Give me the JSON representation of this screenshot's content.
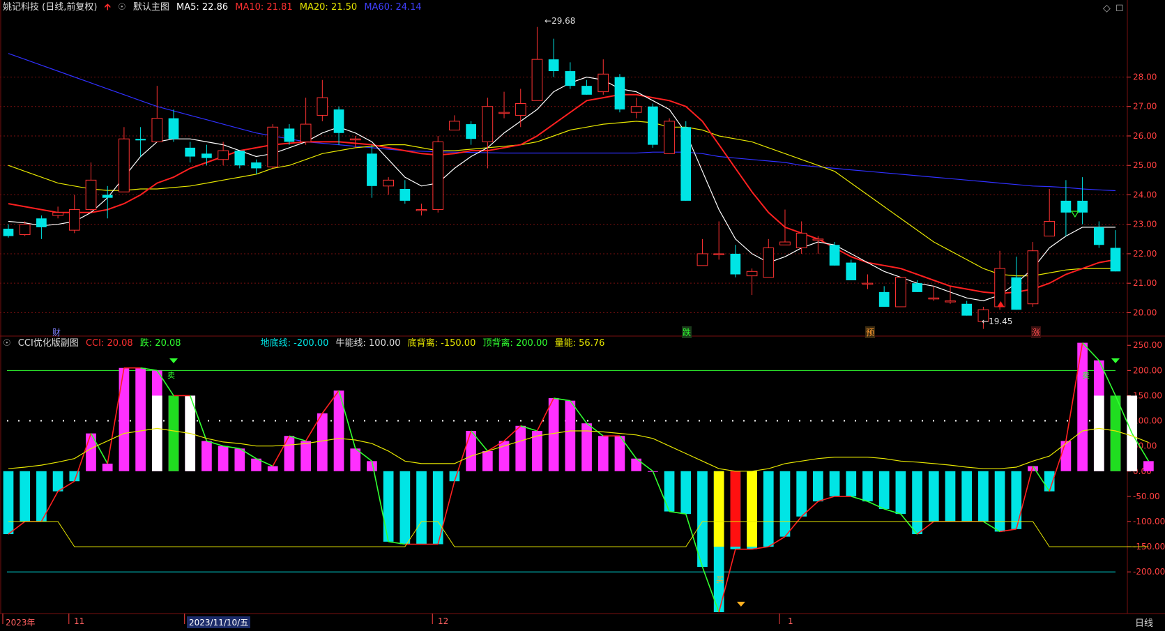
{
  "main_header": {
    "stock": "姚记科技 (日线,前复权)",
    "chart_name": "默认主图",
    "ma5": "MA5: 22.86",
    "ma10": "MA10: 21.81",
    "ma20": "MA20: 21.50",
    "ma60": "MA60: 24.14"
  },
  "sub_header": {
    "name": "CCI优化版副图",
    "cci": "CCI: 20.08",
    "die": "跌: 20.08",
    "floor": "地底线: -200.00",
    "bull": "牛能线: 100.00",
    "bottom_div": "底背离: -150.00",
    "top_div": "顶背离: 200.00",
    "energy": "量能: 56.76"
  },
  "price_axis": [
    "28.00",
    "27.00",
    "26.00",
    "25.00",
    "24.00",
    "23.00",
    "22.00",
    "21.00",
    "20.00"
  ],
  "cci_axis": [
    "250.00",
    "200.00",
    "150.00",
    "100.00",
    "50.00",
    "0.00",
    "-50.00",
    "-100.00",
    "-150.00",
    "-200.00"
  ],
  "time_axis": [
    "2023年",
    "11",
    "2023/11/10/五",
    "12",
    "1"
  ],
  "period_button": "日线",
  "markers": {
    "cai": "财",
    "die": "跌",
    "yu": "预",
    "zhang": "涨",
    "mai": "卖",
    "mai_buy": "买"
  },
  "annotations": {
    "high": "29.68",
    "low": "19.45"
  },
  "colors": {
    "up": "#ff3232",
    "down": "#00e5e5",
    "ma5": "#ffffff",
    "ma10": "#ff2020",
    "ma20": "#e6e600",
    "ma60": "#3030ff",
    "cci_pos": "#ff30ff",
    "cci_neg": "#00e5e5",
    "grid": "#7a1010"
  },
  "chart_data": [
    {
      "type": "candlestick",
      "title": "姚记科技 (日线,前复权)",
      "ylim": [
        19.3,
        30.0
      ],
      "candles": [
        [
          22.85,
          22.6,
          23.0,
          22.55
        ],
        [
          22.65,
          23.0,
          23.1,
          22.6
        ],
        [
          23.2,
          22.9,
          23.3,
          22.5
        ],
        [
          23.3,
          23.4,
          23.6,
          23.2
        ],
        [
          22.8,
          23.5,
          24.0,
          22.7
        ],
        [
          23.5,
          24.5,
          25.1,
          23.4
        ],
        [
          24.0,
          23.9,
          24.3,
          23.2
        ],
        [
          24.1,
          25.9,
          26.3,
          24.1
        ],
        [
          25.9,
          25.85,
          26.3,
          25.3
        ],
        [
          25.8,
          26.6,
          27.7,
          25.8
        ],
        [
          26.6,
          25.9,
          26.9,
          25.8
        ],
        [
          25.6,
          25.3,
          25.8,
          25.1
        ],
        [
          25.4,
          25.25,
          25.7,
          25.0
        ],
        [
          25.2,
          25.5,
          25.8,
          25.0
        ],
        [
          25.5,
          25.0,
          25.5,
          24.9
        ],
        [
          25.1,
          24.9,
          25.2,
          24.7
        ],
        [
          24.95,
          26.3,
          26.4,
          24.9
        ],
        [
          26.25,
          25.8,
          26.4,
          25.7
        ],
        [
          25.8,
          26.4,
          27.3,
          25.7
        ],
        [
          26.7,
          27.3,
          27.9,
          26.5
        ],
        [
          26.9,
          26.1,
          27.0,
          25.7
        ],
        [
          25.9,
          25.9,
          26.0,
          25.6
        ],
        [
          25.4,
          24.3,
          25.7,
          23.9
        ],
        [
          24.3,
          24.5,
          24.6,
          24.0
        ],
        [
          24.2,
          23.8,
          24.5,
          23.7
        ],
        [
          23.5,
          23.5,
          23.7,
          23.3
        ],
        [
          23.5,
          25.8,
          26.0,
          23.4
        ],
        [
          26.2,
          26.5,
          26.7,
          26.2
        ],
        [
          26.4,
          25.9,
          26.5,
          25.7
        ],
        [
          25.8,
          27.0,
          27.3,
          24.9
        ],
        [
          26.8,
          26.8,
          27.5,
          26.6
        ],
        [
          26.7,
          27.1,
          27.6,
          26.3
        ],
        [
          27.2,
          28.6,
          29.7,
          27.2
        ],
        [
          28.6,
          28.2,
          29.3,
          28.0
        ],
        [
          28.2,
          27.7,
          28.5,
          27.6
        ],
        [
          27.7,
          27.4,
          27.9,
          27.4
        ],
        [
          27.5,
          28.1,
          28.6,
          27.4
        ],
        [
          28.0,
          26.9,
          28.1,
          26.8
        ],
        [
          26.8,
          27.0,
          27.3,
          26.6
        ],
        [
          27.0,
          25.7,
          27.1,
          25.6
        ],
        [
          25.4,
          26.5,
          26.6,
          25.4
        ],
        [
          26.3,
          23.8,
          26.5,
          23.8
        ],
        [
          21.6,
          22.0,
          22.5,
          21.6
        ],
        [
          22.0,
          22.0,
          23.1,
          21.8
        ],
        [
          22.0,
          21.3,
          22.3,
          21.2
        ],
        [
          21.25,
          21.4,
          21.5,
          20.6
        ],
        [
          21.2,
          22.2,
          22.5,
          21.2
        ],
        [
          22.3,
          22.4,
          23.5,
          22.3
        ],
        [
          22.2,
          22.7,
          23.1,
          22.0
        ],
        [
          22.5,
          22.5,
          22.6,
          22.0
        ],
        [
          22.3,
          21.6,
          22.4,
          21.6
        ],
        [
          21.7,
          21.1,
          21.8,
          21.1
        ],
        [
          21.0,
          21.0,
          21.3,
          20.8
        ],
        [
          20.7,
          20.2,
          20.9,
          20.2
        ],
        [
          20.2,
          21.2,
          21.2,
          20.2
        ],
        [
          21.0,
          20.7,
          21.1,
          20.7
        ],
        [
          20.5,
          20.5,
          20.9,
          20.4
        ],
        [
          20.4,
          20.4,
          20.9,
          20.3
        ],
        [
          20.3,
          19.9,
          20.4,
          19.9
        ],
        [
          19.7,
          20.1,
          20.2,
          19.45
        ],
        [
          20.2,
          21.5,
          22.1,
          20.1
        ],
        [
          21.2,
          20.1,
          21.9,
          20.1
        ],
        [
          20.3,
          22.1,
          22.4,
          20.2
        ],
        [
          22.6,
          23.1,
          24.2,
          22.6
        ],
        [
          23.8,
          23.4,
          24.5,
          22.6
        ],
        [
          23.8,
          23.4,
          24.6,
          23.0
        ],
        [
          22.9,
          22.3,
          23.1,
          22.2
        ],
        [
          22.2,
          21.4,
          22.8,
          21.4
        ]
      ],
      "ma5": [
        23.1,
        23.05,
        22.95,
        23.0,
        23.1,
        23.4,
        23.9,
        24.6,
        25.3,
        25.8,
        25.9,
        25.9,
        25.8,
        25.7,
        25.5,
        25.3,
        25.4,
        25.6,
        25.8,
        26.1,
        26.3,
        26.1,
        25.8,
        25.2,
        24.6,
        24.3,
        24.4,
        24.9,
        25.3,
        25.6,
        26.1,
        26.5,
        26.9,
        27.5,
        27.8,
        28.0,
        27.9,
        27.6,
        27.5,
        27.2,
        26.9,
        26.1,
        24.8,
        23.5,
        22.5,
        22.0,
        21.7,
        21.9,
        22.2,
        22.4,
        22.3,
        22.0,
        21.7,
        21.4,
        21.2,
        21.0,
        20.9,
        20.7,
        20.5,
        20.4,
        20.6,
        21.0,
        21.5,
        22.2,
        22.6,
        22.9,
        22.9,
        22.9
      ],
      "ma10": [
        23.7,
        23.6,
        23.5,
        23.4,
        23.4,
        23.4,
        23.5,
        23.7,
        24.0,
        24.4,
        24.6,
        24.9,
        25.1,
        25.3,
        25.5,
        25.6,
        25.7,
        25.75,
        25.8,
        25.8,
        25.8,
        25.75,
        25.7,
        25.6,
        25.5,
        25.4,
        25.35,
        25.4,
        25.5,
        25.5,
        25.6,
        25.7,
        26.0,
        26.4,
        26.8,
        27.2,
        27.3,
        27.4,
        27.4,
        27.3,
        27.2,
        27.0,
        26.5,
        25.7,
        24.9,
        24.1,
        23.4,
        22.9,
        22.7,
        22.5,
        22.2,
        21.9,
        21.7,
        21.6,
        21.5,
        21.3,
        21.1,
        20.9,
        20.8,
        20.7,
        20.65,
        20.7,
        20.8,
        21.0,
        21.3,
        21.5,
        21.7,
        21.8
      ],
      "ma20": [
        25.0,
        24.8,
        24.6,
        24.4,
        24.3,
        24.2,
        24.15,
        24.15,
        24.2,
        24.2,
        24.25,
        24.3,
        24.4,
        24.5,
        24.6,
        24.7,
        24.9,
        25.0,
        25.2,
        25.4,
        25.5,
        25.6,
        25.65,
        25.7,
        25.7,
        25.6,
        25.5,
        25.5,
        25.55,
        25.6,
        25.65,
        25.7,
        25.8,
        26.0,
        26.2,
        26.3,
        26.4,
        26.45,
        26.5,
        26.45,
        26.3,
        26.3,
        26.2,
        26.0,
        25.9,
        25.8,
        25.6,
        25.4,
        25.2,
        25.0,
        24.8,
        24.4,
        24.0,
        23.6,
        23.2,
        22.8,
        22.4,
        22.1,
        21.8,
        21.5,
        21.3,
        21.25,
        21.25,
        21.35,
        21.45,
        21.5,
        21.5,
        21.5
      ],
      "ma60": [
        28.8,
        28.6,
        28.4,
        28.2,
        28.0,
        27.8,
        27.6,
        27.4,
        27.2,
        27.0,
        26.85,
        26.7,
        26.55,
        26.4,
        26.25,
        26.1,
        26.0,
        25.9,
        25.8,
        25.75,
        25.7,
        25.65,
        25.6,
        25.55,
        25.5,
        25.48,
        25.46,
        25.45,
        25.44,
        25.43,
        25.42,
        25.42,
        25.42,
        25.42,
        25.42,
        25.42,
        25.42,
        25.42,
        25.42,
        25.45,
        25.45,
        25.45,
        25.4,
        25.3,
        25.25,
        25.2,
        25.15,
        25.1,
        25.0,
        24.95,
        24.9,
        24.85,
        24.8,
        24.75,
        24.7,
        24.65,
        24.6,
        24.55,
        24.5,
        24.45,
        24.4,
        24.35,
        24.3,
        24.28,
        24.25,
        24.2,
        24.17,
        24.14
      ]
    },
    {
      "type": "bar",
      "title": "CCI优化版副图",
      "ylim": [
        -280,
        260
      ],
      "cci": [
        -125,
        -100,
        -100,
        -40,
        -20,
        75,
        15,
        205,
        205,
        200,
        150,
        150,
        60,
        50,
        45,
        25,
        10,
        70,
        60,
        115,
        160,
        45,
        20,
        -140,
        -145,
        -145,
        -145,
        -20,
        80,
        40,
        60,
        90,
        80,
        145,
        140,
        95,
        70,
        70,
        25,
        0,
        -80,
        -85,
        -190,
        -280,
        -155,
        -155,
        -150,
        -130,
        -90,
        -60,
        -50,
        -50,
        -60,
        -75,
        -85,
        -125,
        -100,
        -100,
        -100,
        -100,
        -120,
        -115,
        10,
        -40,
        60,
        255,
        220,
        150,
        75,
        20
      ],
      "cci_ma": [
        5,
        8,
        12,
        18,
        25,
        45,
        60,
        75,
        80,
        85,
        80,
        75,
        65,
        58,
        55,
        50,
        50,
        52,
        55,
        60,
        65,
        62,
        55,
        40,
        20,
        15,
        15,
        15,
        30,
        40,
        50,
        60,
        70,
        75,
        80,
        80,
        78,
        75,
        72,
        65,
        50,
        35,
        20,
        5,
        0,
        0,
        5,
        15,
        20,
        25,
        28,
        28,
        28,
        25,
        20,
        18,
        15,
        12,
        8,
        5,
        5,
        8,
        20,
        30,
        55,
        80,
        85,
        80,
        70,
        57
      ]
    }
  ]
}
